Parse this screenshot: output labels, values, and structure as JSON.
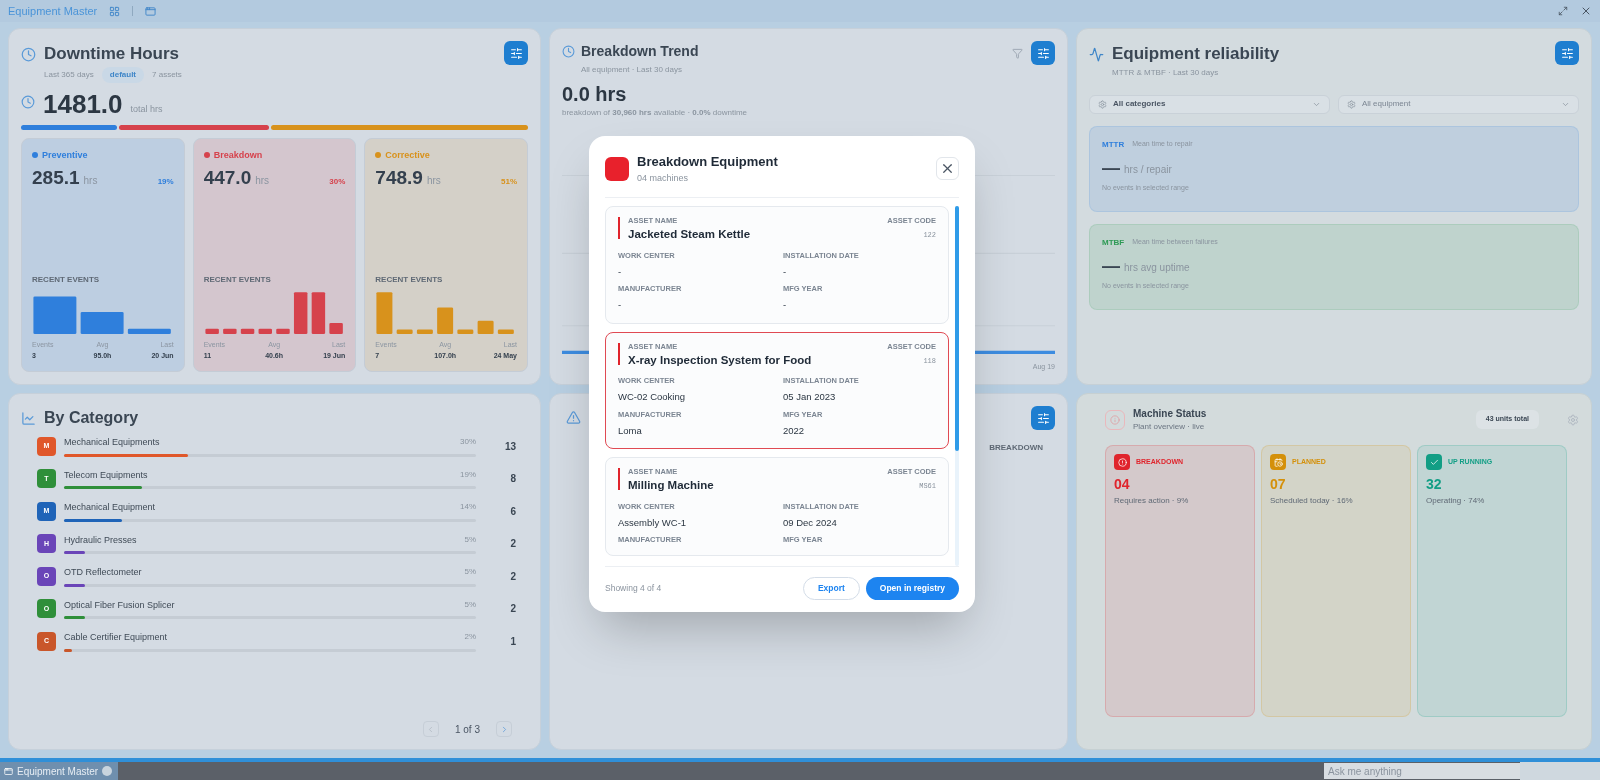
{
  "app_bar": {
    "title": "Equipment Master"
  },
  "downtime": {
    "title": "Downtime Hours",
    "subtitle": "Last 365 days",
    "badge": "default",
    "assets": "7 assets",
    "total": "1481.0",
    "total_unit": "total hrs",
    "segments": [
      {
        "name": "Preventive",
        "value": "285.1",
        "unit": "hrs",
        "share": "19%",
        "color": "#2f7fdc",
        "events_label": "RECENT EVENTS",
        "stats": [
          {
            "label": "Events",
            "value": "3"
          },
          {
            "label": "Avg",
            "value": "95.0h"
          },
          {
            "label": "Last",
            "value": "20 Jun"
          }
        ]
      },
      {
        "name": "Breakdown",
        "value": "447.0",
        "unit": "hrs",
        "share": "30%",
        "color": "#d6424c",
        "events_label": "RECENT EVENTS",
        "stats": [
          {
            "label": "Events",
            "value": "11"
          },
          {
            "label": "Avg",
            "value": "40.6h"
          },
          {
            "label": "Last",
            "value": "19 Jun"
          }
        ]
      },
      {
        "name": "Corrective",
        "value": "748.9",
        "unit": "hrs",
        "share": "51%",
        "color": "#d8921c",
        "events_label": "RECENT EVENTS",
        "stats": [
          {
            "label": "Events",
            "value": "7"
          },
          {
            "label": "Avg",
            "value": "107.0h"
          },
          {
            "label": "Last",
            "value": "24 May"
          }
        ]
      }
    ]
  },
  "category": {
    "title": "By Category",
    "items": [
      {
        "letter": "M",
        "name": "Mechanical Equipments",
        "share": "30%",
        "count": "13",
        "level": 0.3,
        "color": "#e0572a"
      },
      {
        "letter": "T",
        "name": "Telecom Equipments",
        "share": "19%",
        "count": "8",
        "level": 0.19,
        "color": "#2f8f3a"
      },
      {
        "letter": "M",
        "name": "Mechanical Equipment",
        "share": "14%",
        "count": "6",
        "level": 0.14,
        "color": "#1f64b8"
      },
      {
        "letter": "H",
        "name": "Hydraulic Presses",
        "share": "5%",
        "count": "2",
        "level": 0.05,
        "color": "#6a45b8"
      },
      {
        "letter": "O",
        "name": "OTD Reflectometer",
        "share": "5%",
        "count": "2",
        "level": 0.05,
        "color": "#6a45b8"
      },
      {
        "letter": "O",
        "name": "Optical Fiber Fusion Splicer",
        "share": "5%",
        "count": "2",
        "level": 0.05,
        "color": "#2f8f3a"
      },
      {
        "letter": "C",
        "name": "Cable Certifier Equipment",
        "share": "2%",
        "count": "1",
        "level": 0.02,
        "color": "#c9562a"
      }
    ],
    "pager": "1 of 3"
  },
  "trend": {
    "title": "Breakdown Trend",
    "subtitle": "All equipment · Last 30 days",
    "value": "0.0 hrs",
    "caption": "breakdown of **30,960 hrs** available · **0.0%** downtime",
    "x_end": "Aug 19"
  },
  "reliability": {
    "title": "Equipment reliability",
    "subtitle": "MTTR & MTBF · Last 30 days",
    "filters": [
      {
        "value": "All categories",
        "selected": true
      },
      {
        "value": "All equipment",
        "selected": false
      }
    ],
    "metrics": [
      {
        "code": "MTTR",
        "desc": "Mean time to repair",
        "value": "—",
        "unit": "hrs / repair",
        "note": "No events in selected range",
        "color": "#2f7fdc"
      },
      {
        "code": "MTBF",
        "desc": "Mean time between failures",
        "value": "—",
        "unit": "hrs avg uptime",
        "note": "No events in selected range",
        "color": "#2e9a55"
      }
    ]
  },
  "analysis": {
    "column": "BREAKDOWN"
  },
  "status": {
    "title": "Machine Status",
    "subtitle": "Plant overview · live",
    "total": "43 units total",
    "tiles": [
      {
        "kind": "alert",
        "label": "BREAKDOWN",
        "count": "04",
        "note": "Requires action · 9%",
        "color": "#e0242c"
      },
      {
        "kind": "planned",
        "label": "PLANNED",
        "count": "07",
        "note": "Scheduled today · 16%",
        "color": "#d4900a"
      },
      {
        "kind": "running",
        "label": "UP RUNNING",
        "count": "32",
        "note": "Operating · 74%",
        "color": "#129e85"
      }
    ]
  },
  "taskbar": {
    "app": "Equipment Master",
    "search": {
      "placeholder": "Ask me anything"
    }
  },
  "modal": {
    "title": "Breakdown Equipment",
    "subtitle": "04 machines",
    "footer": "Showing 4 of 4",
    "items": [
      {
        "name_label": "ASSET NAME",
        "name": "Jacketed Steam Kettle",
        "code_label": "ASSET CODE",
        "code": "122",
        "selected": false,
        "fields": [
          {
            "label": "WORK CENTER",
            "value": "-"
          },
          {
            "label": "INSTALLATION DATE",
            "value": "-"
          },
          {
            "label": "MANUFACTURER",
            "value": "-"
          },
          {
            "label": "MFG YEAR",
            "value": "-"
          }
        ]
      },
      {
        "name_label": "ASSET NAME",
        "name": "X-ray Inspection System for Food",
        "code_label": "ASSET CODE",
        "code": "118",
        "selected": true,
        "fields": [
          {
            "label": "WORK CENTER",
            "value": "WC-02 Cooking"
          },
          {
            "label": "INSTALLATION DATE",
            "value": "05 Jan 2023"
          },
          {
            "label": "MANUFACTURER",
            "value": "Loma"
          },
          {
            "label": "MFG YEAR",
            "value": "2022"
          }
        ]
      },
      {
        "name_label": "ASSET NAME",
        "name": "Milling Machine",
        "code_label": "ASSET CODE",
        "code": "MS61",
        "selected": false,
        "fields": [
          {
            "label": "WORK CENTER",
            "value": "Assembly WC-1"
          },
          {
            "label": "INSTALLATION DATE",
            "value": "09 Dec 2024"
          },
          {
            "label": "MANUFACTURER"
          },
          {
            "label": "MFG YEAR"
          }
        ]
      }
    ],
    "buttons": [
      {
        "label": "Export",
        "kind": "secondary"
      },
      {
        "label": "Open in registry",
        "kind": "primary"
      }
    ]
  }
}
